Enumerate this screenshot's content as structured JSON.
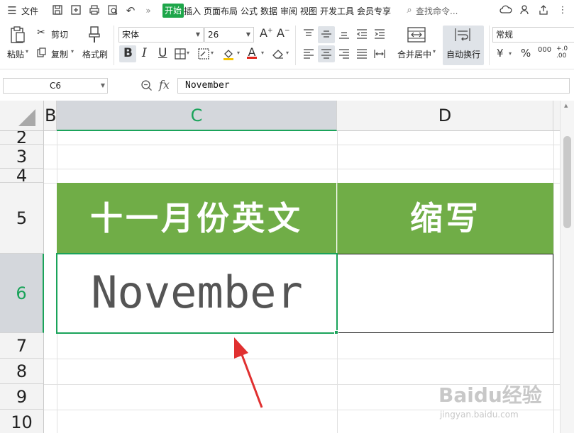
{
  "menu": {
    "file": "文件",
    "tabs": [
      "开始",
      "插入",
      "页面布局",
      "公式",
      "数据",
      "审阅",
      "视图",
      "开发工具",
      "会员专享"
    ],
    "active_tab": "开始",
    "search_placeholder": "查找命令..."
  },
  "ribbon": {
    "paste": "粘贴",
    "cut": "剪切",
    "copy": "复制",
    "format_painter": "格式刷",
    "font_name": "宋体",
    "font_size": "26",
    "bold": "B",
    "italic": "I",
    "underline": "U",
    "merge_center": "合并居中",
    "wrap_text": "自动换行",
    "number_format": "常规",
    "currency": "¥",
    "percent": "%",
    "thousands": "000",
    "dec_add": "+.0",
    "dec_remove": ".00"
  },
  "formula_bar": {
    "cell_ref": "C6",
    "fx_label": "fx",
    "content": "November"
  },
  "sheet": {
    "columns": [
      "B",
      "C",
      "D"
    ],
    "active_column": "C",
    "rows": [
      "2",
      "3",
      "4",
      "5",
      "6",
      "7",
      "8",
      "9",
      "10"
    ],
    "active_row": "6",
    "header_c": "十一月份英文",
    "header_d": "缩写",
    "c6_value": "November",
    "d6_value": ""
  },
  "colors": {
    "accent": "#1aa35a",
    "header_fill": "#70ad47",
    "header_text": "#ffffff",
    "arrow": "#e03030"
  },
  "watermark": {
    "brand": "Baidu经验",
    "url": "jingyan.baidu.com"
  }
}
